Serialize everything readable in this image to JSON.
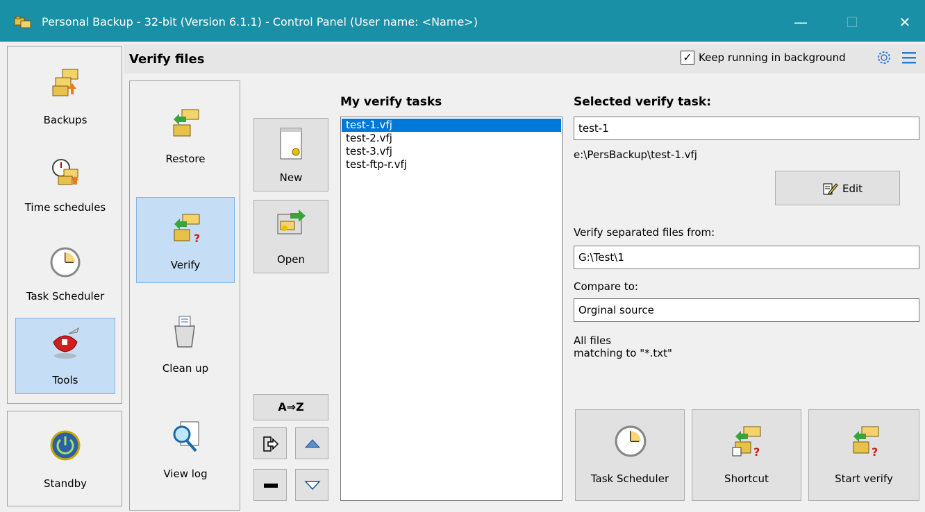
{
  "window": {
    "title": "Personal Backup - 32-bit (Version 6.1.1) - Control Panel (User name: <Name>)",
    "minimize": "—",
    "maximize": "☐",
    "close": "✕"
  },
  "header": {
    "title": "Verify files",
    "keep_running_label": "Keep running in background",
    "keep_running_checked": true,
    "checkmark": "✓"
  },
  "main_nav": [
    {
      "label": "Backups",
      "icon": "backup-folders-icon"
    },
    {
      "label": "Time schedules",
      "icon": "stopwatch-folders-icon"
    },
    {
      "label": "Task Scheduler",
      "icon": "clock-icon"
    },
    {
      "label": "Tools",
      "icon": "swiss-knife-icon",
      "selected": true
    }
  ],
  "standby": {
    "label": "Standby",
    "icon": "power-icon"
  },
  "tools_nav": [
    {
      "label": "Restore",
      "icon": "restore-folders-icon"
    },
    {
      "label": "Verify",
      "icon": "verify-folders-icon",
      "selected": true
    },
    {
      "label": "Clean up",
      "icon": "trash-can-icon"
    },
    {
      "label": "View log",
      "icon": "log-magnifier-icon"
    }
  ],
  "task_buttons": {
    "new_label": "New",
    "open_label": "Open",
    "sort_label": "A⇒Z"
  },
  "tasks": {
    "heading": "My verify tasks",
    "items": [
      "test-1.vfj",
      "test-2.vfj",
      "test-3.vfj",
      "test-ftp-r.vfj"
    ],
    "selected_index": 0
  },
  "selected_task": {
    "heading": "Selected verify task:",
    "name": "test-1",
    "path": "e:\\PersBackup\\test-1.vfj",
    "edit_label": "Edit",
    "verify_from_label": "Verify separated files from:",
    "verify_from_value": "G:\\Test\\1",
    "compare_label": "Compare to:",
    "compare_value": "Orginal source",
    "filter_line1": "All files",
    "filter_line2": "matching to \"*.txt\""
  },
  "actions": {
    "task_scheduler_label": "Task Scheduler",
    "shortcut_label": "Shortcut",
    "start_verify_label": "Start verify"
  },
  "colors": {
    "titlebar": "#1990a5",
    "selection": "#0078d7",
    "selected_nav": "#c5def5",
    "menu_icon": "#2a7bd4"
  }
}
